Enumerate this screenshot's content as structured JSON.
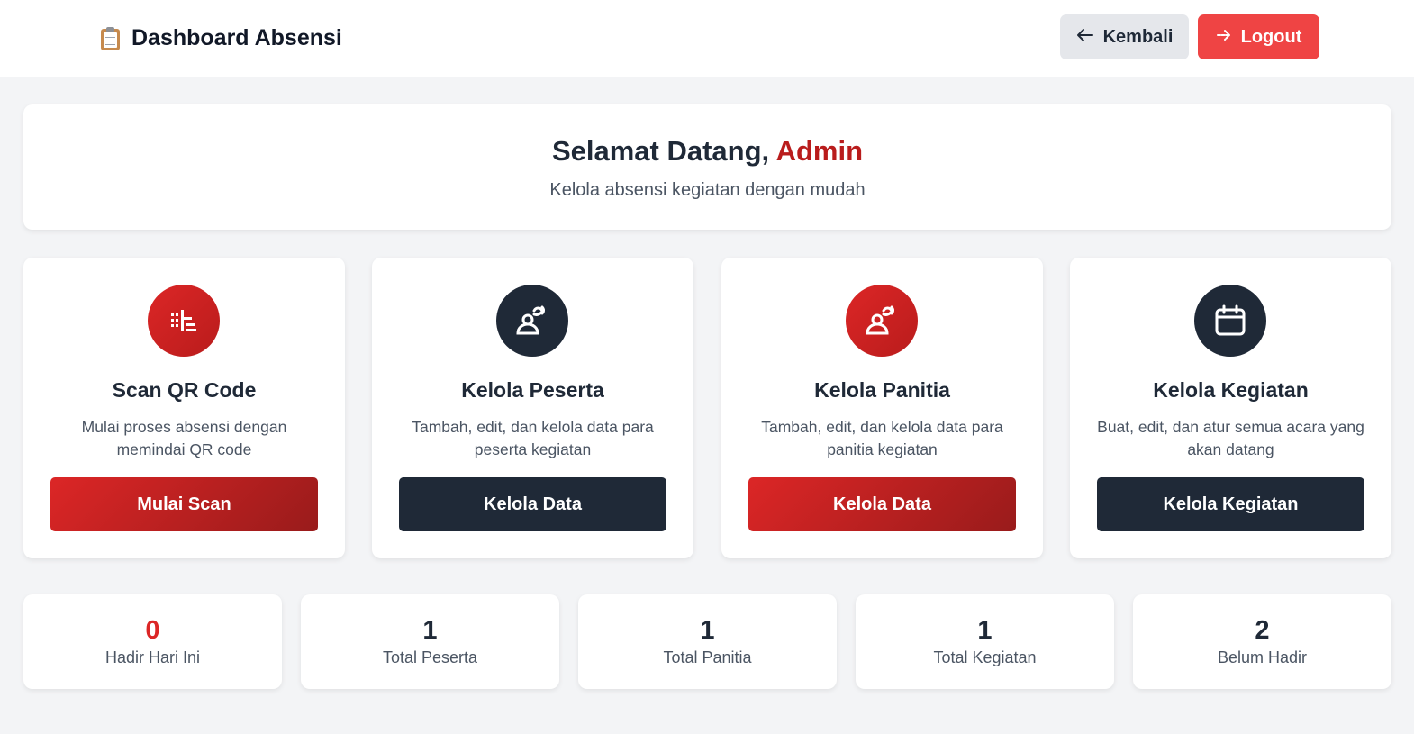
{
  "header": {
    "title": "Dashboard Absensi",
    "back_label": "Kembali",
    "logout_label": "Logout"
  },
  "welcome": {
    "greeting": "Selamat Datang,",
    "name": "Admin",
    "subtitle": "Kelola absensi kegiatan dengan mudah"
  },
  "cards": [
    {
      "icon": "qr-scan-icon",
      "title": "Scan QR Code",
      "description": "Mulai proses absensi dengan memindai QR code",
      "button": "Mulai Scan",
      "theme": "red"
    },
    {
      "icon": "user-group-icon",
      "title": "Kelola Peserta",
      "description": "Tambah, edit, dan kelola data para peserta kegiatan",
      "button": "Kelola Data",
      "theme": "dark"
    },
    {
      "icon": "user-group-icon",
      "title": "Kelola Panitia",
      "description": "Tambah, edit, dan kelola data para panitia kegiatan",
      "button": "Kelola Data",
      "theme": "red"
    },
    {
      "icon": "calendar-icon",
      "title": "Kelola Kegiatan",
      "description": "Buat, edit, dan atur semua acara yang akan datang",
      "button": "Kelola Kegiatan",
      "theme": "dark"
    }
  ],
  "stats": [
    {
      "value": "0",
      "label": "Hadir Hari Ini",
      "color": "#dc2626"
    },
    {
      "value": "1",
      "label": "Total Peserta",
      "color": "#1f2937"
    },
    {
      "value": "1",
      "label": "Total Panitia",
      "color": "#1f2937"
    },
    {
      "value": "1",
      "label": "Total Kegiatan",
      "color": "#1f2937"
    },
    {
      "value": "2",
      "label": "Belum Hadir",
      "color": "#1f2937"
    }
  ],
  "colors": {
    "accent_red": "#dc2626",
    "dark": "#1f2937",
    "logout": "#ef4444"
  }
}
